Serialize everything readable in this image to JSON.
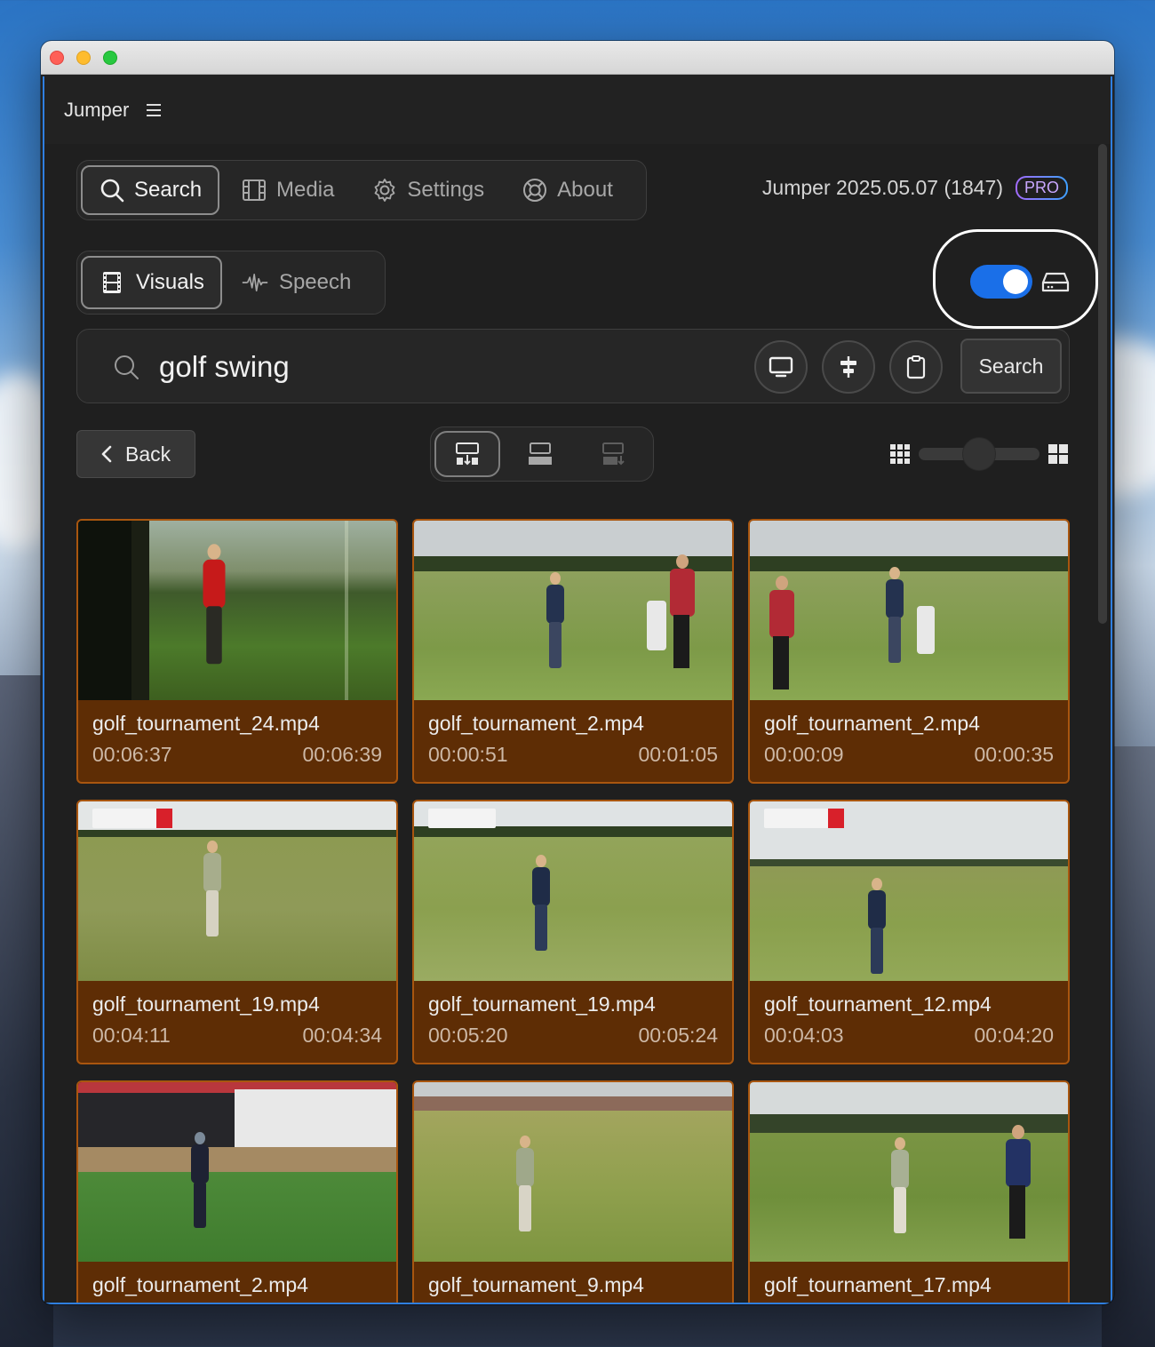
{
  "app": {
    "name": "Jumper",
    "version_label": "Jumper 2025.05.07 (1847)",
    "pro_badge": "PRO"
  },
  "nav": {
    "tabs": [
      {
        "label": "Search",
        "icon": "search-icon",
        "active": true
      },
      {
        "label": "Media",
        "icon": "film-icon",
        "active": false
      },
      {
        "label": "Settings",
        "icon": "gear-icon",
        "active": false
      },
      {
        "label": "About",
        "icon": "lifebuoy-icon",
        "active": false
      }
    ]
  },
  "modes": [
    {
      "label": "Visuals",
      "icon": "film-strip-icon",
      "active": true
    },
    {
      "label": "Speech",
      "icon": "waveform-icon",
      "active": false
    }
  ],
  "toggle": {
    "on": true,
    "color": "#1a6fe8"
  },
  "search": {
    "query": "golf swing",
    "button_label": "Search",
    "tool_icons": [
      "monitor-icon",
      "align-center-icon",
      "clipboard-icon"
    ]
  },
  "toolbar": {
    "back_label": "Back",
    "view_modes": [
      "layout-stack-down-icon",
      "layout-filmstrip-icon",
      "layout-stack-dim-icon"
    ],
    "active_view_index": 0,
    "zoom_fraction": 0.5
  },
  "colors": {
    "card_bg": "#5e2d05",
    "card_border": "#a9560f",
    "accent": "#1a6fe8"
  },
  "results": [
    {
      "file": "golf_tournament_24.mp4",
      "start": "00:06:37",
      "end": "00:06:39"
    },
    {
      "file": "golf_tournament_2.mp4",
      "start": "00:00:51",
      "end": "00:01:05"
    },
    {
      "file": "golf_tournament_2.mp4",
      "start": "00:00:09",
      "end": "00:00:35"
    },
    {
      "file": "golf_tournament_19.mp4",
      "start": "00:04:11",
      "end": "00:04:34"
    },
    {
      "file": "golf_tournament_19.mp4",
      "start": "00:05:20",
      "end": "00:05:24"
    },
    {
      "file": "golf_tournament_12.mp4",
      "start": "00:04:03",
      "end": "00:04:20"
    },
    {
      "file": "golf_tournament_2.mp4",
      "start": "",
      "end": ""
    },
    {
      "file": "golf_tournament_9.mp4",
      "start": "",
      "end": ""
    },
    {
      "file": "golf_tournament_17.mp4",
      "start": "",
      "end": ""
    }
  ]
}
